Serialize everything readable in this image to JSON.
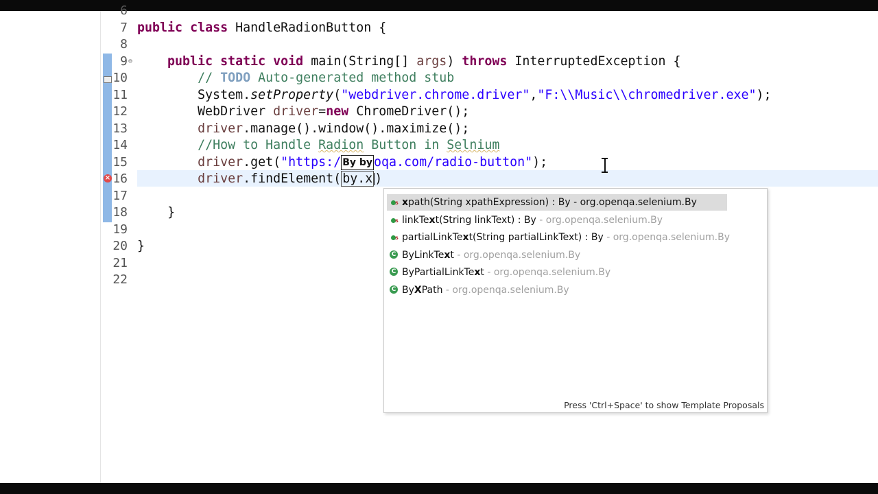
{
  "editor": {
    "lines": [
      {
        "number": "6"
      },
      {
        "number": "7",
        "parts": [
          {
            "t": "public",
            "c": "kw"
          },
          {
            "t": " "
          },
          {
            "t": "class",
            "c": "kw"
          },
          {
            "t": " HandleRadionButton {"
          }
        ]
      },
      {
        "number": "8",
        "parts": []
      },
      {
        "number": "9",
        "parts": [
          {
            "t": "    "
          },
          {
            "t": "public",
            "c": "kw"
          },
          {
            "t": " "
          },
          {
            "t": "static",
            "c": "kw"
          },
          {
            "t": " "
          },
          {
            "t": "void",
            "c": "kw"
          },
          {
            "t": " main(String[] "
          },
          {
            "t": "args",
            "c": "var"
          },
          {
            "t": ") "
          },
          {
            "t": "throws",
            "c": "kw"
          },
          {
            "t": " InterruptedException {"
          }
        ]
      },
      {
        "number": "10",
        "parts": [
          {
            "t": "        "
          },
          {
            "t": "// ",
            "c": "cm"
          },
          {
            "t": "TODO",
            "c": "todo"
          },
          {
            "t": " Auto-generated method stub",
            "c": "cm"
          }
        ]
      },
      {
        "number": "11",
        "parts": [
          {
            "t": "        System."
          },
          {
            "t": "setProperty",
            "c": "it"
          },
          {
            "t": "("
          },
          {
            "t": "\"webdriver.chrome.driver\"",
            "c": "str"
          },
          {
            "t": ","
          },
          {
            "t": "\"F:\\\\Music\\\\chromedriver.exe\"",
            "c": "str"
          },
          {
            "t": ");"
          }
        ]
      },
      {
        "number": "12",
        "parts": [
          {
            "t": "        WebDriver "
          },
          {
            "t": "driver",
            "c": "var"
          },
          {
            "t": "="
          },
          {
            "t": "new",
            "c": "kw"
          },
          {
            "t": " ChromeDriver();"
          }
        ]
      },
      {
        "number": "13",
        "parts": [
          {
            "t": "        "
          },
          {
            "t": "driver",
            "c": "var"
          },
          {
            "t": ".manage().window().maximize();"
          }
        ]
      },
      {
        "number": "14",
        "parts": [
          {
            "t": "        "
          },
          {
            "t": "//How to Handle ",
            "c": "cm"
          },
          {
            "t": "Radion",
            "c": "cm squiggle"
          },
          {
            "t": " Button in ",
            "c": "cm"
          },
          {
            "t": "Selnium",
            "c": "cm squiggle"
          }
        ]
      },
      {
        "number": "15",
        "parts": [
          {
            "t": "        "
          },
          {
            "t": "driver",
            "c": "var"
          },
          {
            "t": ".get("
          },
          {
            "t": "\"https:/",
            "c": "str"
          },
          {
            "t": "By by",
            "c": "hover-box"
          },
          {
            "t": "oqa.com/radio-button\"",
            "c": "str"
          },
          {
            "t": ");"
          }
        ]
      },
      {
        "number": "16",
        "parts": [
          {
            "t": "        "
          },
          {
            "t": "driver",
            "c": "var"
          },
          {
            "t": ".findElement("
          },
          {
            "t": "by.x",
            "c": "linked-box"
          },
          {
            "t": "",
            "c": "caret"
          },
          {
            "t": ")"
          }
        ]
      },
      {
        "number": "17",
        "parts": []
      },
      {
        "number": "18",
        "parts": [
          {
            "t": "    }"
          }
        ]
      },
      {
        "number": "19",
        "parts": []
      },
      {
        "number": "20",
        "parts": [
          {
            "t": "}"
          }
        ]
      },
      {
        "number": "21",
        "parts": []
      },
      {
        "number": "22",
        "parts": []
      }
    ]
  },
  "autocomplete": {
    "proposals": [
      {
        "icon": "static-method-icon",
        "name_pre": "",
        "hl": "x",
        "name_post": "path(String xpathExpression) : By - org.openqa.selenium.By",
        "pkg": "",
        "selected": true
      },
      {
        "icon": "static-method-icon",
        "name_pre": "linkTe",
        "hl": "x",
        "name_post": "t(String linkText) : By",
        "pkg": " - org.openqa.selenium.By",
        "selected": false
      },
      {
        "icon": "static-method-icon",
        "name_pre": "partialLinkTe",
        "hl": "x",
        "name_post": "t(String partialLinkText) : By",
        "pkg": " - org.openqa.selenium.By",
        "selected": false
      },
      {
        "icon": "class-icon",
        "name_pre": "ByLinkTe",
        "hl": "x",
        "name_post": "t",
        "pkg": " - org.openqa.selenium.By",
        "selected": false
      },
      {
        "icon": "class-icon",
        "name_pre": "ByPartialLinkTe",
        "hl": "x",
        "name_post": "t",
        "pkg": " - org.openqa.selenium.By",
        "selected": false
      },
      {
        "icon": "class-icon",
        "name_pre": "By",
        "hl": "X",
        "name_post": "Path",
        "pkg": " - org.openqa.selenium.By",
        "selected": false
      }
    ],
    "footer": "Press 'Ctrl+Space' to show Template Proposals"
  }
}
